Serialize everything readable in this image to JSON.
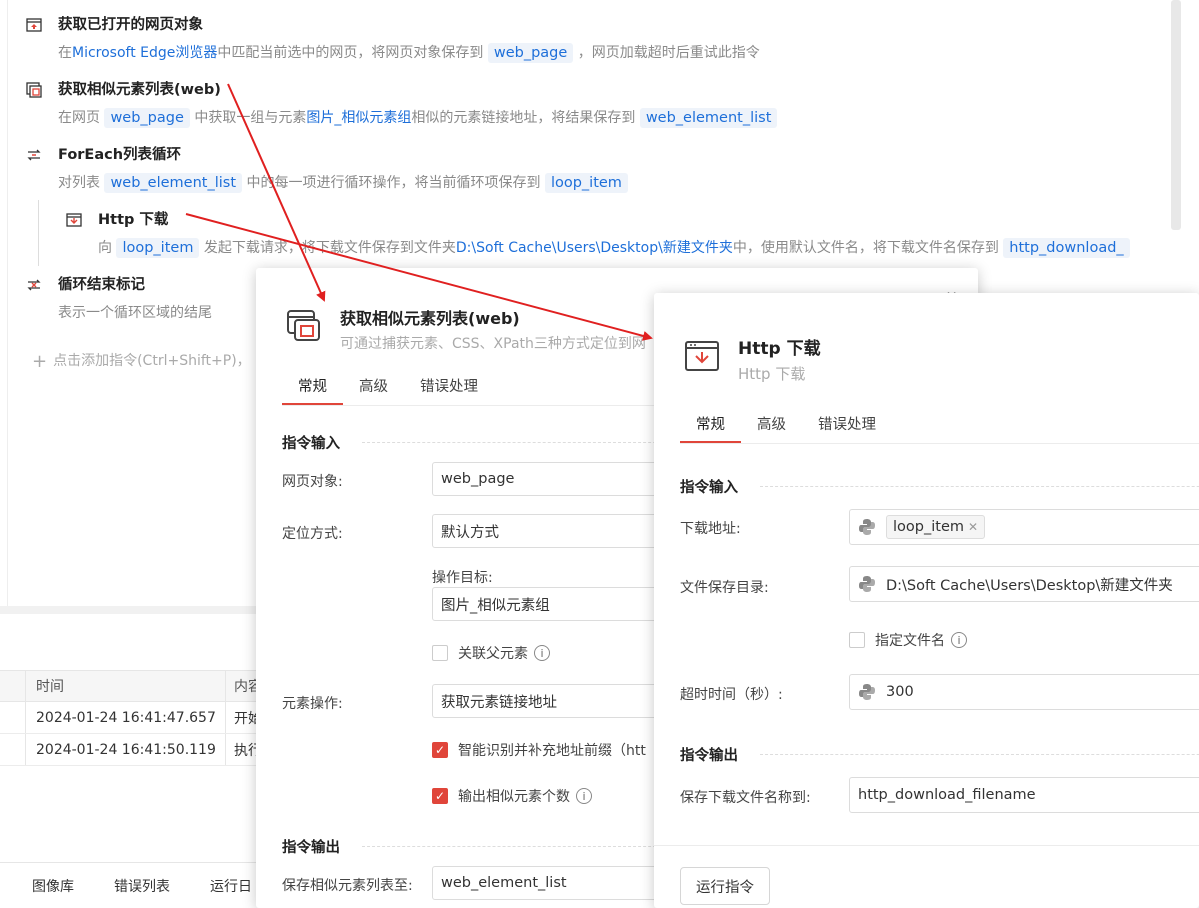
{
  "flow": {
    "cmd1": {
      "title": "获取已打开的网页对象",
      "desc_pre": "在",
      "desc_browser": "Microsoft Edge浏览器",
      "desc_mid": "中匹配当前选中的网页，将网页对象保存到",
      "desc_var": "web_page",
      "desc_post": "，网页加载超时后重试此指令"
    },
    "cmd2": {
      "title": "获取相似元素列表(web)",
      "desc_pre": "在网页",
      "desc_var1": "web_page",
      "desc_mid": "中获取一组与元素",
      "desc_elem": "图片_相似元素组",
      "desc_mid2": "相似的元素链接地址，将结果保存到",
      "desc_var2": "web_element_list"
    },
    "cmd3": {
      "title": "ForEach列表循环",
      "desc_pre": "对列表",
      "desc_var1": "web_element_list",
      "desc_mid": "中的每一项进行循环操作，将当前循环项保存到",
      "desc_var2": "loop_item"
    },
    "cmd4": {
      "title": "Http 下载",
      "desc_pre": "向",
      "desc_var1": "loop_item",
      "desc_mid": "发起下载请求，将下载文件保存到文件夹",
      "desc_path": "D:\\Soft Cache\\Users\\Desktop\\新建文件夹",
      "desc_mid2": "中，使用默认文件名，将下载文件名保存到",
      "desc_var2": "http_download_"
    },
    "cmd5": {
      "title": "循环结束标记",
      "desc": "表示一个循环区域的结尾"
    },
    "add_command": "点击添加指令(Ctrl+Shift+P)，"
  },
  "log": {
    "headers": [
      "时间",
      "内容"
    ],
    "rows": [
      {
        "time": "2024-01-24 16:41:47.657",
        "content": "开始"
      },
      {
        "time": "2024-01-24 16:41:50.119",
        "content": "执行"
      }
    ]
  },
  "bottom_tabs": [
    "图像库",
    "错误列表",
    "运行日"
  ],
  "dialog1": {
    "title": "获取相似元素列表(web)",
    "subtitle": "可通过捕获元素、CSS、XPath三种方式定位到网",
    "tabs": [
      "常规",
      "高级",
      "错误处理"
    ],
    "section_input": "指令输入",
    "label_page": "网页对象:",
    "value_page": "web_page",
    "label_locate": "定位方式:",
    "value_locate": "默认方式",
    "label_target": "操作目标:",
    "value_target": "图片_相似元素组",
    "chk_parent": "关联父元素",
    "label_op": "元素操作:",
    "value_op": "获取元素链接地址",
    "chk_prefix": "智能识别并补充地址前缀（htt",
    "chk_count": "输出相似元素个数",
    "section_output": "指令输出",
    "label_save": "保存相似元素列表至:",
    "value_save": "web_element_list"
  },
  "dialog2": {
    "title": "Http 下载",
    "subtitle": "Http 下载",
    "tabs": [
      "常规",
      "高级",
      "错误处理"
    ],
    "section_input": "指令输入",
    "label_url": "下载地址:",
    "value_url": "loop_item",
    "label_dir": "文件保存目录:",
    "value_dir": "D:\\Soft Cache\\Users\\Desktop\\新建文件夹",
    "chk_filename": "指定文件名",
    "label_timeout": "超时时间（秒）:",
    "value_timeout": "300",
    "section_output": "指令输出",
    "label_save": "保存下载文件名称到:",
    "value_save": "http_download_filename",
    "run_button": "运行指令"
  },
  "colors": {
    "accent": "#e0453a",
    "link": "#1e6fd9",
    "arrow": "#e02020"
  }
}
